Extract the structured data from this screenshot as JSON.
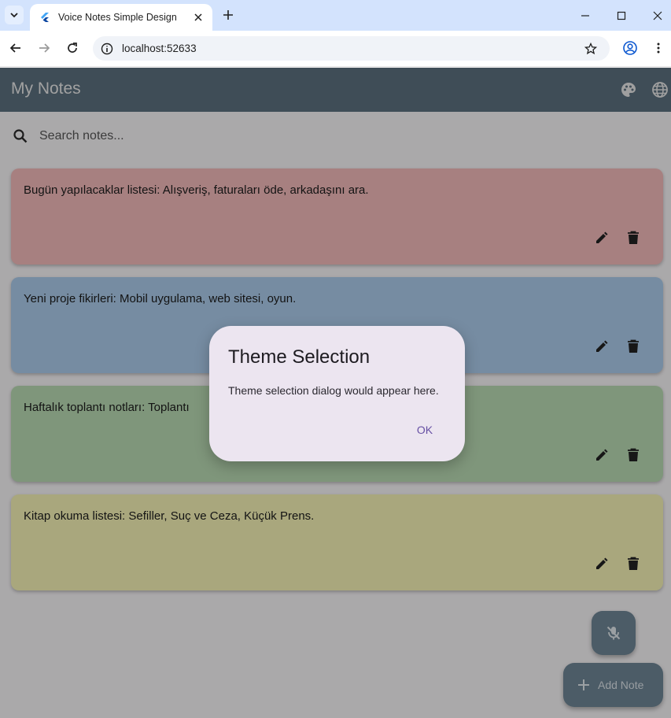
{
  "browser": {
    "tab_title": "Voice Notes Simple Design",
    "url": "localhost:52633"
  },
  "app": {
    "title": "My Notes",
    "search_placeholder": "Search notes...",
    "notes": [
      {
        "text": "Bugün yapılacaklar listesi: Alışveriş, faturaları öde, arkadaşını ara.",
        "color": "#f0b8b8"
      },
      {
        "text": "Yeni proje fikirleri: Mobil uygulama, web sitesi, oyun.",
        "color": "#a9c9e8"
      },
      {
        "text": "Haftalık toplantı notları: Toplantı",
        "color": "#b6d7b0"
      },
      {
        "text": "Kitap okuma listesi: Sefiller, Suç ve Ceza, Küçük Prens.",
        "color": "#f2efb4"
      }
    ],
    "fab_add_label": "Add Note"
  },
  "dialog": {
    "title": "Theme Selection",
    "body": "Theme selection dialog would appear here.",
    "ok_label": "OK"
  },
  "colors": {
    "appbar": "#5b6f7d",
    "accent": "#6750a4"
  }
}
